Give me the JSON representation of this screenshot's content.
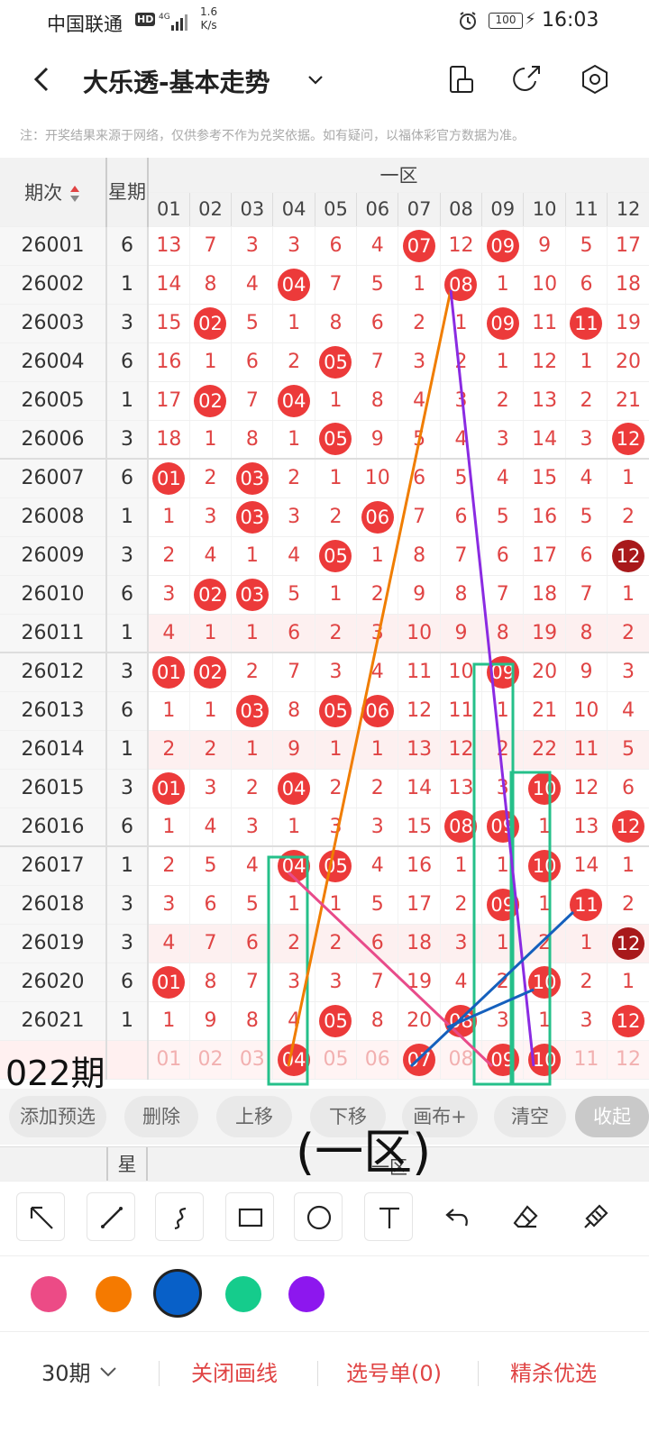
{
  "status_bar": {
    "carrier": "中国联通",
    "hd": "HD",
    "network": "4G",
    "speed_value": "1.6",
    "speed_unit": "K/s",
    "battery": "100",
    "time": "16:03"
  },
  "nav": {
    "title": "大乐透-基本走势"
  },
  "note": "注：开奖结果来源于网络，仅供参考不作为兑奖依据。如有疑问，以福体彩官方数据为准。",
  "table": {
    "period_header": "期次",
    "week_header": "星期",
    "zone_header": "一区",
    "columns": [
      "01",
      "02",
      "03",
      "04",
      "05",
      "06",
      "07",
      "08",
      "09",
      "10",
      "11",
      "12"
    ],
    "rows": [
      {
        "period": "26001",
        "week": "6",
        "cells": [
          {
            "v": "13"
          },
          {
            "v": "7"
          },
          {
            "v": "3"
          },
          {
            "v": "3"
          },
          {
            "v": "6"
          },
          {
            "v": "4"
          },
          {
            "v": "07",
            "b": 1
          },
          {
            "v": "12"
          },
          {
            "v": "09",
            "b": 1
          },
          {
            "v": "9"
          },
          {
            "v": "5"
          },
          {
            "v": "17"
          }
        ]
      },
      {
        "period": "26002",
        "week": "1",
        "cells": [
          {
            "v": "14"
          },
          {
            "v": "8"
          },
          {
            "v": "4"
          },
          {
            "v": "04",
            "b": 1
          },
          {
            "v": "7"
          },
          {
            "v": "5"
          },
          {
            "v": "1"
          },
          {
            "v": "08",
            "b": 1
          },
          {
            "v": "1"
          },
          {
            "v": "10"
          },
          {
            "v": "6"
          },
          {
            "v": "18"
          }
        ]
      },
      {
        "period": "26003",
        "week": "3",
        "cells": [
          {
            "v": "15"
          },
          {
            "v": "02",
            "b": 1
          },
          {
            "v": "5"
          },
          {
            "v": "1"
          },
          {
            "v": "8"
          },
          {
            "v": "6"
          },
          {
            "v": "2"
          },
          {
            "v": "1"
          },
          {
            "v": "09",
            "b": 1
          },
          {
            "v": "11"
          },
          {
            "v": "11",
            "b": 1
          },
          {
            "v": "19"
          }
        ]
      },
      {
        "period": "26004",
        "week": "6",
        "cells": [
          {
            "v": "16"
          },
          {
            "v": "1"
          },
          {
            "v": "6"
          },
          {
            "v": "2"
          },
          {
            "v": "05",
            "b": 1
          },
          {
            "v": "7"
          },
          {
            "v": "3"
          },
          {
            "v": "2"
          },
          {
            "v": "1"
          },
          {
            "v": "12"
          },
          {
            "v": "1"
          },
          {
            "v": "20"
          }
        ]
      },
      {
        "period": "26005",
        "week": "1",
        "cells": [
          {
            "v": "17"
          },
          {
            "v": "02",
            "b": 1
          },
          {
            "v": "7"
          },
          {
            "v": "04",
            "b": 1
          },
          {
            "v": "1"
          },
          {
            "v": "8"
          },
          {
            "v": "4"
          },
          {
            "v": "3"
          },
          {
            "v": "2"
          },
          {
            "v": "13"
          },
          {
            "v": "2"
          },
          {
            "v": "21"
          }
        ]
      },
      {
        "period": "26006",
        "week": "3",
        "cells": [
          {
            "v": "18"
          },
          {
            "v": "1"
          },
          {
            "v": "8"
          },
          {
            "v": "1"
          },
          {
            "v": "05",
            "b": 1
          },
          {
            "v": "9"
          },
          {
            "v": "5"
          },
          {
            "v": "4"
          },
          {
            "v": "3"
          },
          {
            "v": "14"
          },
          {
            "v": "3"
          },
          {
            "v": "12",
            "b": 1
          }
        ]
      },
      {
        "period": "26007",
        "week": "6",
        "cells": [
          {
            "v": "01",
            "b": 1
          },
          {
            "v": "2"
          },
          {
            "v": "03",
            "b": 1
          },
          {
            "v": "2"
          },
          {
            "v": "1"
          },
          {
            "v": "10"
          },
          {
            "v": "6"
          },
          {
            "v": "5"
          },
          {
            "v": "4"
          },
          {
            "v": "15"
          },
          {
            "v": "4"
          },
          {
            "v": "1"
          }
        ]
      },
      {
        "period": "26008",
        "week": "1",
        "cells": [
          {
            "v": "1"
          },
          {
            "v": "3"
          },
          {
            "v": "03",
            "b": 1
          },
          {
            "v": "3"
          },
          {
            "v": "2"
          },
          {
            "v": "06",
            "b": 1
          },
          {
            "v": "7"
          },
          {
            "v": "6"
          },
          {
            "v": "5"
          },
          {
            "v": "16"
          },
          {
            "v": "5"
          },
          {
            "v": "2"
          }
        ]
      },
      {
        "period": "26009",
        "week": "3",
        "cells": [
          {
            "v": "2"
          },
          {
            "v": "4"
          },
          {
            "v": "1"
          },
          {
            "v": "4"
          },
          {
            "v": "05",
            "b": 1
          },
          {
            "v": "1"
          },
          {
            "v": "8"
          },
          {
            "v": "7"
          },
          {
            "v": "6"
          },
          {
            "v": "17"
          },
          {
            "v": "6"
          },
          {
            "v": "12",
            "b": 2
          }
        ]
      },
      {
        "period": "26010",
        "week": "6",
        "cells": [
          {
            "v": "3"
          },
          {
            "v": "02",
            "b": 1
          },
          {
            "v": "03",
            "b": 1
          },
          {
            "v": "5"
          },
          {
            "v": "1"
          },
          {
            "v": "2"
          },
          {
            "v": "9"
          },
          {
            "v": "8"
          },
          {
            "v": "7"
          },
          {
            "v": "18"
          },
          {
            "v": "7"
          },
          {
            "v": "1"
          }
        ]
      },
      {
        "period": "26011",
        "week": "1",
        "cells": [
          {
            "v": "4"
          },
          {
            "v": "1"
          },
          {
            "v": "1"
          },
          {
            "v": "6"
          },
          {
            "v": "2"
          },
          {
            "v": "3"
          },
          {
            "v": "10"
          },
          {
            "v": "9"
          },
          {
            "v": "8"
          },
          {
            "v": "19"
          },
          {
            "v": "8"
          },
          {
            "v": "2"
          }
        ]
      },
      {
        "period": "26012",
        "week": "3",
        "cells": [
          {
            "v": "01",
            "b": 1
          },
          {
            "v": "02",
            "b": 1
          },
          {
            "v": "2"
          },
          {
            "v": "7"
          },
          {
            "v": "3"
          },
          {
            "v": "4"
          },
          {
            "v": "11"
          },
          {
            "v": "10"
          },
          {
            "v": "09",
            "b": 1
          },
          {
            "v": "20"
          },
          {
            "v": "9"
          },
          {
            "v": "3"
          }
        ]
      },
      {
        "period": "26013",
        "week": "6",
        "cells": [
          {
            "v": "1"
          },
          {
            "v": "1"
          },
          {
            "v": "03",
            "b": 1
          },
          {
            "v": "8"
          },
          {
            "v": "05",
            "b": 1
          },
          {
            "v": "06",
            "b": 1
          },
          {
            "v": "12"
          },
          {
            "v": "11"
          },
          {
            "v": "1"
          },
          {
            "v": "21"
          },
          {
            "v": "10"
          },
          {
            "v": "4"
          }
        ]
      },
      {
        "period": "26014",
        "week": "1",
        "cells": [
          {
            "v": "2"
          },
          {
            "v": "2"
          },
          {
            "v": "1"
          },
          {
            "v": "9"
          },
          {
            "v": "1"
          },
          {
            "v": "1"
          },
          {
            "v": "13"
          },
          {
            "v": "12"
          },
          {
            "v": "2"
          },
          {
            "v": "22"
          },
          {
            "v": "11"
          },
          {
            "v": "5"
          }
        ]
      },
      {
        "period": "26015",
        "week": "3",
        "cells": [
          {
            "v": "01",
            "b": 1
          },
          {
            "v": "3"
          },
          {
            "v": "2"
          },
          {
            "v": "04",
            "b": 1
          },
          {
            "v": "2"
          },
          {
            "v": "2"
          },
          {
            "v": "14"
          },
          {
            "v": "13"
          },
          {
            "v": "3"
          },
          {
            "v": "10",
            "b": 1
          },
          {
            "v": "12"
          },
          {
            "v": "6"
          }
        ]
      },
      {
        "period": "26016",
        "week": "6",
        "cells": [
          {
            "v": "1"
          },
          {
            "v": "4"
          },
          {
            "v": "3"
          },
          {
            "v": "1"
          },
          {
            "v": "3"
          },
          {
            "v": "3"
          },
          {
            "v": "15"
          },
          {
            "v": "08",
            "b": 1
          },
          {
            "v": "09",
            "b": 1
          },
          {
            "v": "1"
          },
          {
            "v": "13"
          },
          {
            "v": "12",
            "b": 1
          }
        ]
      },
      {
        "period": "26017",
        "week": "1",
        "cells": [
          {
            "v": "2"
          },
          {
            "v": "5"
          },
          {
            "v": "4"
          },
          {
            "v": "04",
            "b": 1
          },
          {
            "v": "05",
            "b": 1
          },
          {
            "v": "4"
          },
          {
            "v": "16"
          },
          {
            "v": "1"
          },
          {
            "v": "1"
          },
          {
            "v": "10",
            "b": 1
          },
          {
            "v": "14"
          },
          {
            "v": "1"
          }
        ]
      },
      {
        "period": "26018",
        "week": "3",
        "cells": [
          {
            "v": "3"
          },
          {
            "v": "6"
          },
          {
            "v": "5"
          },
          {
            "v": "1"
          },
          {
            "v": "1"
          },
          {
            "v": "5"
          },
          {
            "v": "17"
          },
          {
            "v": "2"
          },
          {
            "v": "09",
            "b": 1
          },
          {
            "v": "1"
          },
          {
            "v": "11",
            "b": 1
          },
          {
            "v": "2"
          }
        ]
      },
      {
        "period": "26019",
        "week": "3",
        "cells": [
          {
            "v": "4"
          },
          {
            "v": "7"
          },
          {
            "v": "6"
          },
          {
            "v": "2"
          },
          {
            "v": "2"
          },
          {
            "v": "6"
          },
          {
            "v": "18"
          },
          {
            "v": "3"
          },
          {
            "v": "1"
          },
          {
            "v": "2"
          },
          {
            "v": "1"
          },
          {
            "v": "12",
            "b": 2
          }
        ]
      },
      {
        "period": "26020",
        "week": "6",
        "cells": [
          {
            "v": "01",
            "b": 1
          },
          {
            "v": "8"
          },
          {
            "v": "7"
          },
          {
            "v": "3"
          },
          {
            "v": "3"
          },
          {
            "v": "7"
          },
          {
            "v": "19"
          },
          {
            "v": "4"
          },
          {
            "v": "2"
          },
          {
            "v": "10",
            "b": 1
          },
          {
            "v": "2"
          },
          {
            "v": "1"
          }
        ]
      },
      {
        "period": "26021",
        "week": "1",
        "cells": [
          {
            "v": "1"
          },
          {
            "v": "9"
          },
          {
            "v": "8"
          },
          {
            "v": "4"
          },
          {
            "v": "05",
            "b": 1
          },
          {
            "v": "8"
          },
          {
            "v": "20"
          },
          {
            "v": "08",
            "b": 1
          },
          {
            "v": "3"
          },
          {
            "v": "1"
          },
          {
            "v": "3"
          },
          {
            "v": "12",
            "b": 1
          }
        ]
      }
    ],
    "prediction_row": {
      "period": "",
      "week": "",
      "cells": [
        {
          "v": "01"
        },
        {
          "v": "02"
        },
        {
          "v": "03"
        },
        {
          "v": "04",
          "b": 1
        },
        {
          "v": "05"
        },
        {
          "v": "06"
        },
        {
          "v": "07",
          "b": 1
        },
        {
          "v": "08"
        },
        {
          "v": "09",
          "b": 1
        },
        {
          "v": "10",
          "b": 1
        },
        {
          "v": "11"
        },
        {
          "v": "12"
        }
      ]
    }
  },
  "annotations": {
    "qi_label": "022期",
    "zone_label": "(一区)",
    "line_colors": [
      "#f07d00",
      "#8a2be2",
      "#e84b8a",
      "#1560bd"
    ]
  },
  "actions": {
    "add_preselect": "添加预选",
    "delete": "删除",
    "move_up": "上移",
    "move_down": "下移",
    "canvas": "画布+",
    "clear": "清空",
    "collapse": "收起"
  },
  "repeat_header": {
    "week": "星",
    "zone": "一区"
  },
  "tools": [
    "arrow-tool",
    "line-tool",
    "curve-tool",
    "rect-tool",
    "circle-tool",
    "text-tool",
    "undo-tool",
    "eraser-tool",
    "brush-tool"
  ],
  "palette": [
    {
      "name": "pink",
      "color": "#ec4b86"
    },
    {
      "name": "orange",
      "color": "#f57a00"
    },
    {
      "name": "blue",
      "color": "#0860c8",
      "selected": true
    },
    {
      "name": "green",
      "color": "#15cc8c"
    },
    {
      "name": "purple",
      "color": "#8d17ee"
    }
  ],
  "bottom": {
    "period_select": "30期",
    "close_draw": "关闭画线",
    "pick_list": "选号单(0)",
    "optimize": "精杀优选"
  }
}
